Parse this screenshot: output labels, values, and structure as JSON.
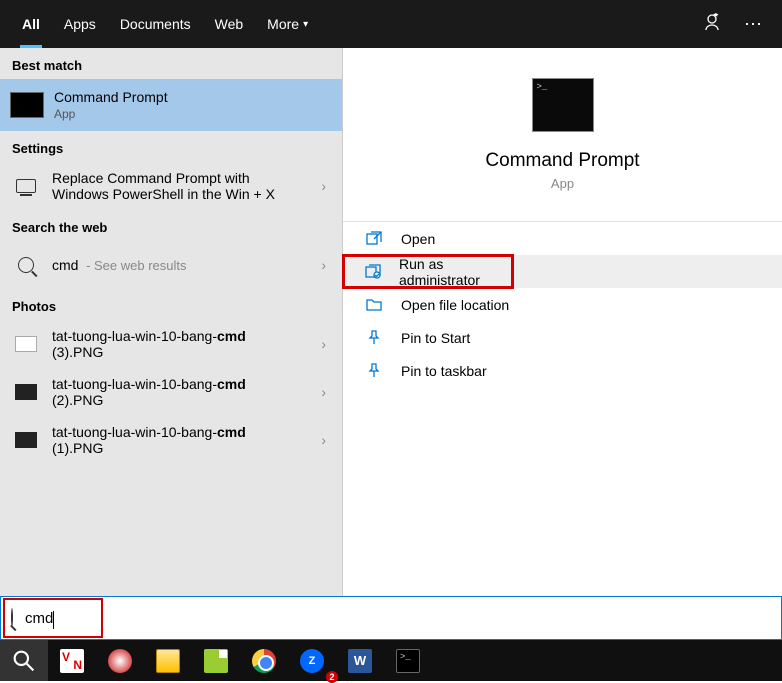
{
  "tabs": {
    "all": "All",
    "apps": "Apps",
    "documents": "Documents",
    "web": "Web",
    "more": "More"
  },
  "sections": {
    "best_match": "Best match",
    "settings": "Settings",
    "search_web": "Search the web",
    "photos": "Photos"
  },
  "best": {
    "title": "Command Prompt",
    "sub": "App"
  },
  "settings_item": {
    "line1": "Replace Command Prompt with",
    "line2": "Windows PowerShell in the Win + X"
  },
  "web_item": {
    "query": "cmd",
    "suffix": " - See web results"
  },
  "photos": [
    {
      "prefix": "tat-tuong-lua-win-10-bang-",
      "bold": "cmd",
      "line2": "(3).PNG",
      "light": true
    },
    {
      "prefix": "tat-tuong-lua-win-10-bang-",
      "bold": "cmd",
      "line2": "(2).PNG",
      "light": false
    },
    {
      "prefix": "tat-tuong-lua-win-10-bang-",
      "bold": "cmd",
      "line2": "(1).PNG",
      "light": false
    }
  ],
  "preview": {
    "title": "Command Prompt",
    "sub": "App"
  },
  "actions": {
    "open": "Open",
    "run_admin": "Run as administrator",
    "open_loc": "Open file location",
    "pin_start": "Pin to Start",
    "pin_task": "Pin to taskbar"
  },
  "search": {
    "value": "cmd"
  },
  "taskbar": {
    "zalo_label": "Z",
    "word_label": "W"
  }
}
